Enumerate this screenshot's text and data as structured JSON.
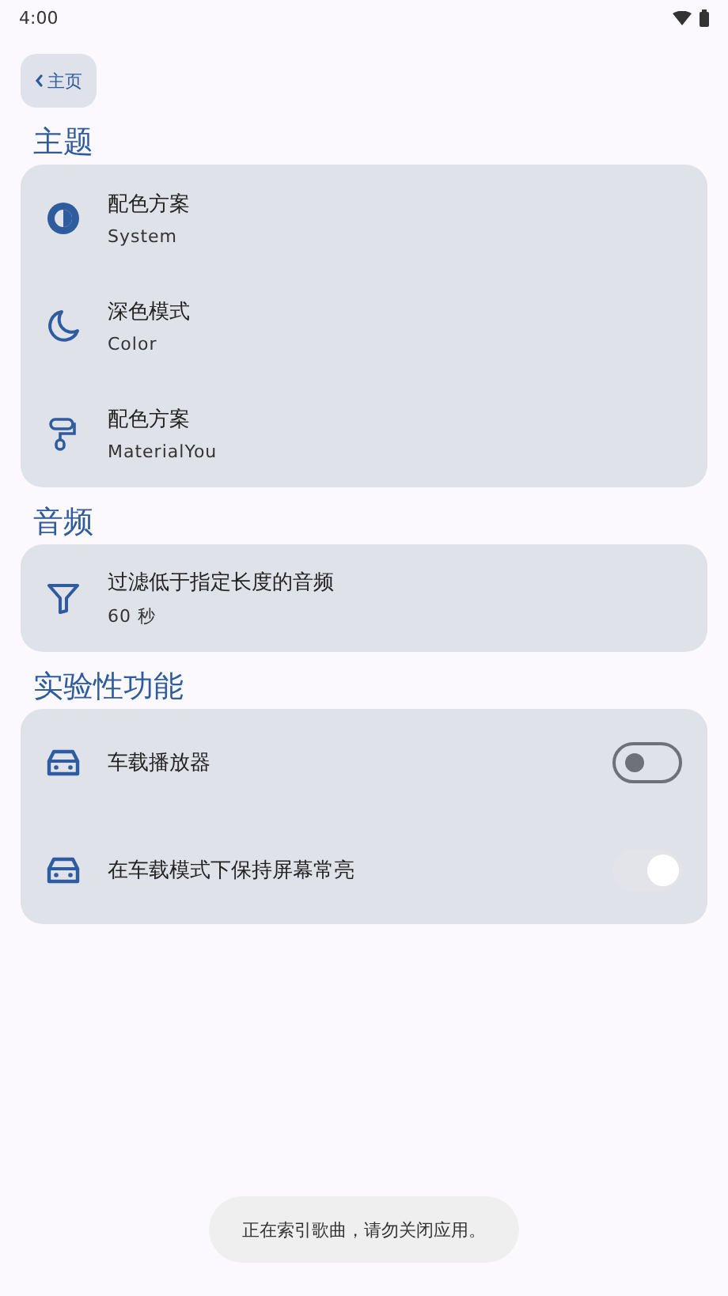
{
  "status_bar": {
    "time": "4:00"
  },
  "back_button": {
    "label": "主页"
  },
  "sections": [
    {
      "title": "主题",
      "items": [
        {
          "kind": "info",
          "title": "配色方案",
          "subtitle": "System"
        },
        {
          "kind": "info",
          "title": "深色模式",
          "subtitle": "Color"
        },
        {
          "kind": "info",
          "title": "配色方案",
          "subtitle": "MaterialYou"
        }
      ]
    },
    {
      "title": "音频",
      "items": [
        {
          "kind": "info",
          "title": "过滤低于指定长度的音频",
          "subtitle": "60 秒"
        }
      ]
    },
    {
      "title": "实验性功能",
      "items": [
        {
          "kind": "switch",
          "title": "车载播放器",
          "on": false,
          "disabled": false
        },
        {
          "kind": "switch",
          "title": "在车载模式下保持屏幕常亮",
          "on": true,
          "disabled": true
        }
      ]
    }
  ],
  "toast": "正在索引歌曲，请勿关闭应用。"
}
